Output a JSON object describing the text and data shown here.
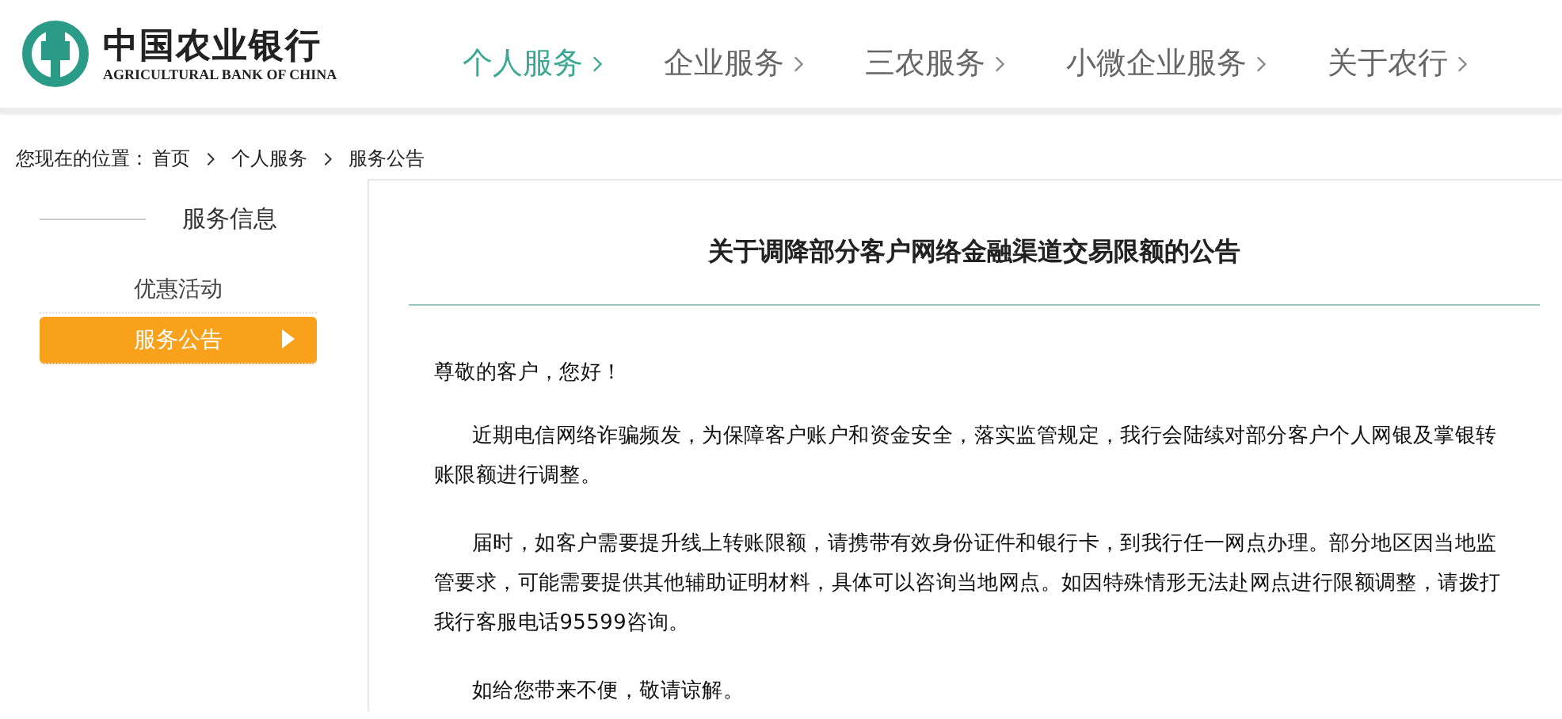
{
  "logo": {
    "name_cn": "中国农业银行",
    "name_en": "AGRICULTURAL BANK OF CHINA"
  },
  "nav": [
    {
      "label": "个人服务",
      "selected": true
    },
    {
      "label": "企业服务",
      "selected": false
    },
    {
      "label": "三农服务",
      "selected": false
    },
    {
      "label": "小微企业服务",
      "selected": false
    },
    {
      "label": "关于农行",
      "selected": false
    }
  ],
  "breadcrumb": {
    "prefix": "您现在的位置：",
    "items": [
      "首页",
      "个人服务",
      "服务公告"
    ]
  },
  "sidebar": {
    "heading": "服务信息",
    "items": [
      {
        "label": "优惠活动",
        "selected": false
      },
      {
        "label": "服务公告",
        "selected": true
      }
    ]
  },
  "article": {
    "title": "关于调降部分客户网络金融渠道交易限额的公告",
    "greeting": "尊敬的客户，您好！",
    "paragraphs": [
      "近期电信网络诈骗频发，为保障客户账户和资金安全，落实监管规定，我行会陆续对部分客户个人网银及掌银转账限额进行调整。",
      "届时，如客户需要提升线上转账限额，请携带有效身份证件和银行卡，到我行任一网点办理。部分地区因当地监管要求，可能需要提供其他辅助证明材料，具体可以咨询当地网点。如因特殊情形无法赴网点进行限额调整，请拨打我行客服电话95599咨询。",
      "如给您带来不便，敬请谅解。"
    ]
  }
}
